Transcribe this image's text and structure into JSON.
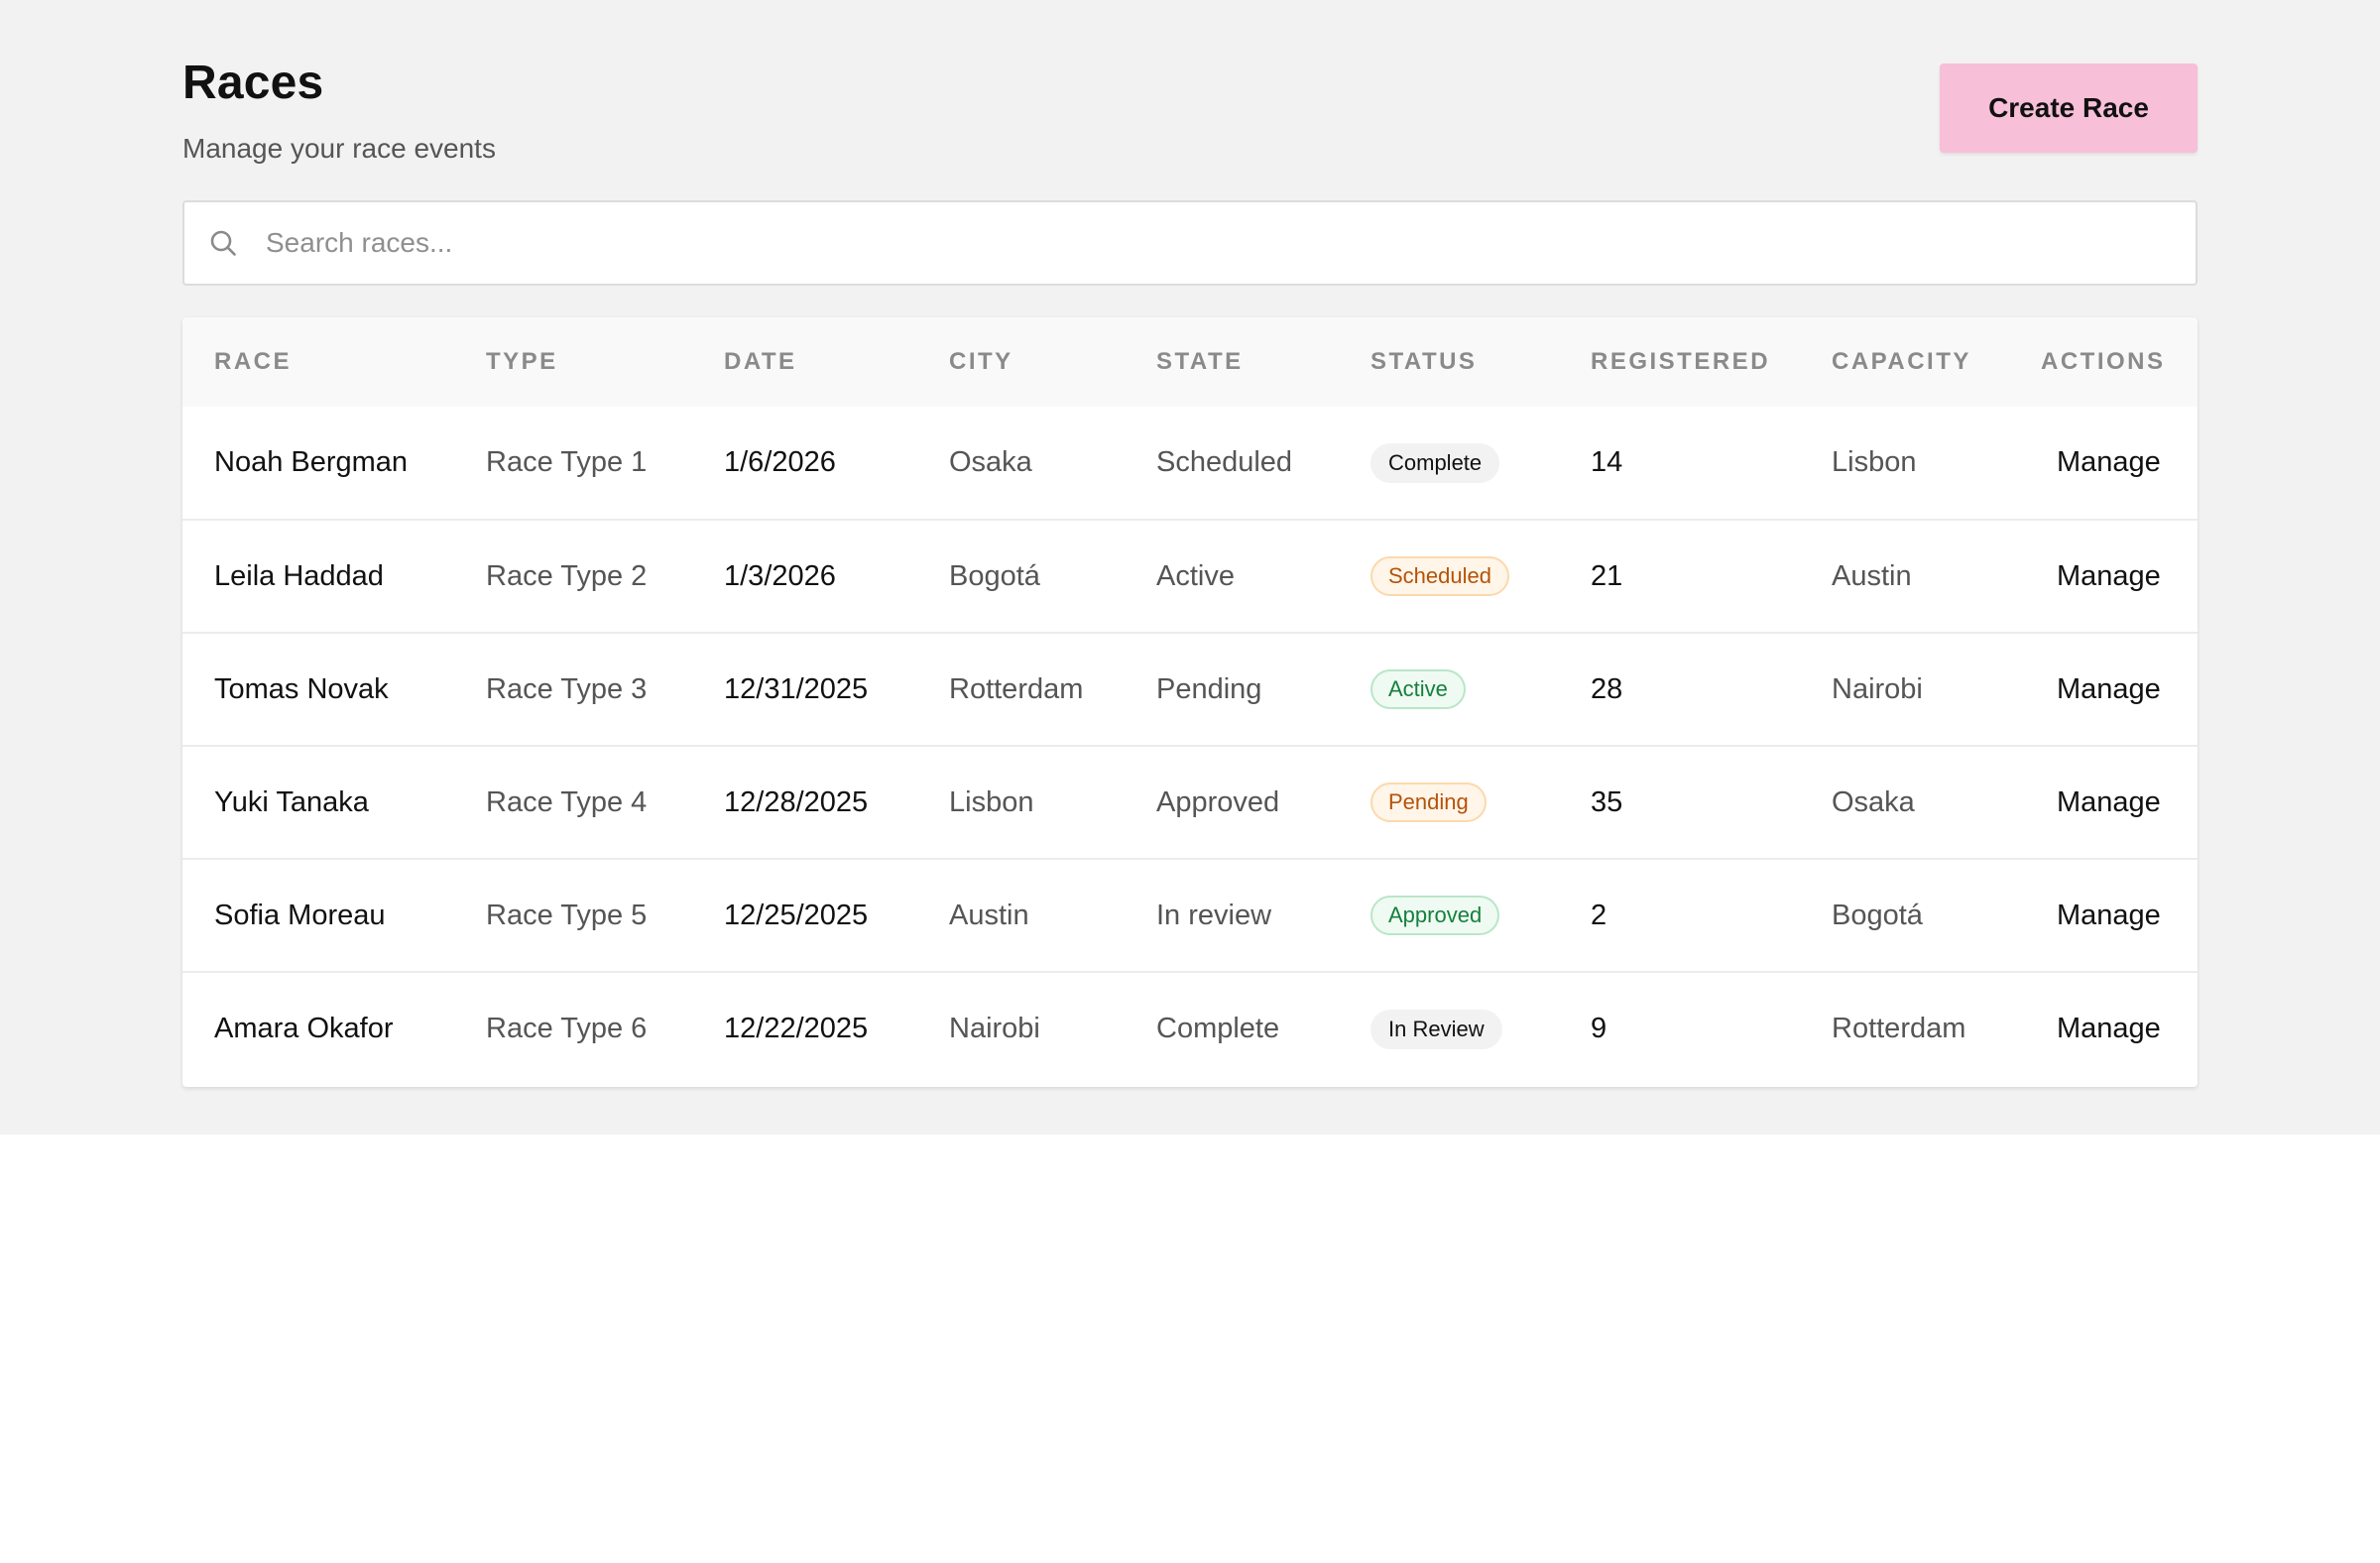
{
  "header": {
    "title": "Races",
    "subtitle": "Manage your race events",
    "create_label": "Create Race"
  },
  "search": {
    "placeholder": "Search races...",
    "icon": "search-icon"
  },
  "table": {
    "columns": [
      "RACE",
      "TYPE",
      "DATE",
      "CITY",
      "STATE",
      "STATUS",
      "REGISTERED",
      "CAPACITY",
      "ACTIONS"
    ],
    "rows": [
      {
        "race": "Noah Bergman",
        "type": "Race Type 1",
        "date": "1/6/2026",
        "city": "Osaka",
        "state": "Scheduled",
        "status": "Complete",
        "status_kind": "neutral",
        "registered": "14",
        "capacity": "Lisbon",
        "action": "Manage"
      },
      {
        "race": "Leila Haddad",
        "type": "Race Type 2",
        "date": "1/3/2026",
        "city": "Bogotá",
        "state": "Active",
        "status": "Scheduled",
        "status_kind": "warning",
        "registered": "21",
        "capacity": "Austin",
        "action": "Manage"
      },
      {
        "race": "Tomas Novak",
        "type": "Race Type 3",
        "date": "12/31/2025",
        "city": "Rotterdam",
        "state": "Pending",
        "status": "Active",
        "status_kind": "success",
        "registered": "28",
        "capacity": "Nairobi",
        "action": "Manage"
      },
      {
        "race": "Yuki Tanaka",
        "type": "Race Type 4",
        "date": "12/28/2025",
        "city": "Lisbon",
        "state": "Approved",
        "status": "Pending",
        "status_kind": "warning",
        "registered": "35",
        "capacity": "Osaka",
        "action": "Manage"
      },
      {
        "race": "Sofia Moreau",
        "type": "Race Type 5",
        "date": "12/25/2025",
        "city": "Austin",
        "state": "In review",
        "status": "Approved",
        "status_kind": "success",
        "registered": "2",
        "capacity": "Bogotá",
        "action": "Manage"
      },
      {
        "race": "Amara Okafor",
        "type": "Race Type 6",
        "date": "12/22/2025",
        "city": "Nairobi",
        "state": "Complete",
        "status": "In Review",
        "status_kind": "neutral",
        "registered": "9",
        "capacity": "Rotterdam",
        "action": "Manage"
      }
    ]
  },
  "colors": {
    "page_background": "#f2f2f2",
    "primary_button": "#f7bfd8",
    "badge_warning": "#b45309",
    "badge_success": "#15803d"
  }
}
